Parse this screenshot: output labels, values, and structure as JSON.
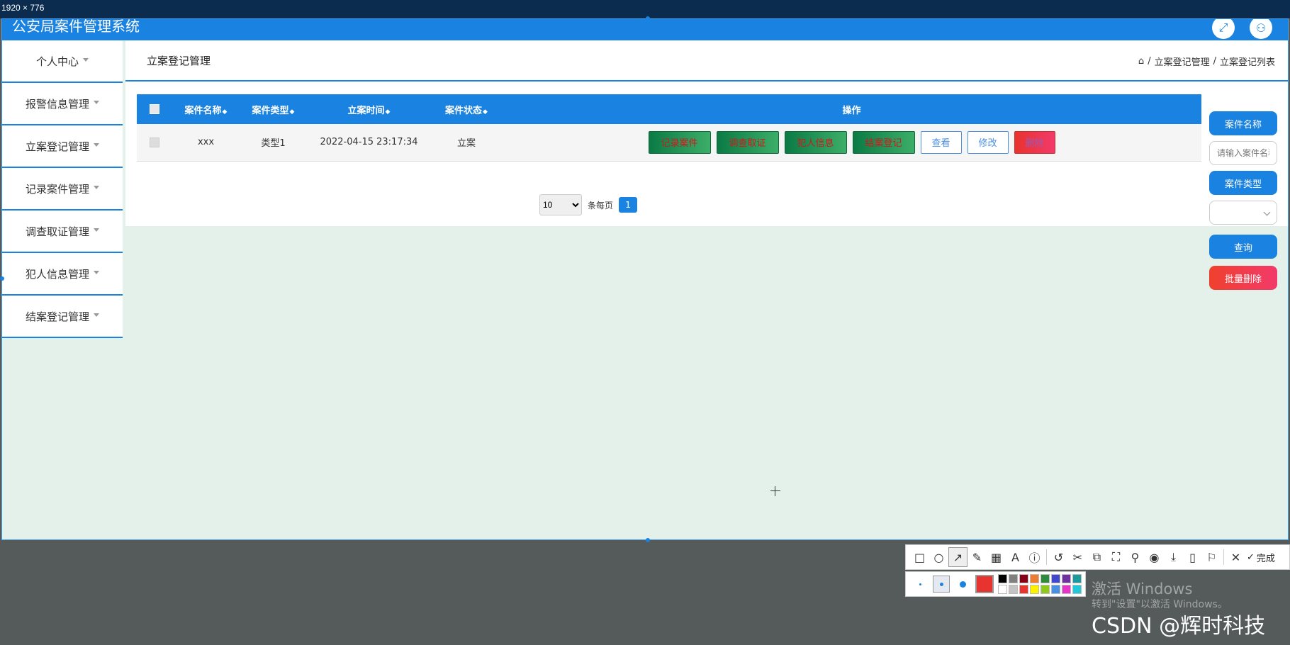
{
  "screen": {
    "dimension_label": "1920 × 776"
  },
  "header": {
    "title": "公安局案件管理系统"
  },
  "sidebar": {
    "items": [
      {
        "label": "个人中心"
      },
      {
        "label": "报警信息管理"
      },
      {
        "label": "立案登记管理"
      },
      {
        "label": "记录案件管理"
      },
      {
        "label": "调查取证管理"
      },
      {
        "label": "犯人信息管理"
      },
      {
        "label": "结案登记管理"
      }
    ]
  },
  "panel": {
    "title": "立案登记管理",
    "breadcrumb": [
      "立案登记管理",
      "立案登记列表"
    ],
    "breadcrumb_sep": "/"
  },
  "table": {
    "columns": [
      "案件名称",
      "案件类型",
      "立案时间",
      "案件状态",
      "操作"
    ],
    "sort_glyph": "◆",
    "rows": [
      {
        "name": "xxx",
        "type": "类型1",
        "time": "2022-04-15 23:17:34",
        "status": "立案",
        "actions": {
          "record": "记录案件",
          "investigate": "调查取证",
          "criminal": "犯人信息",
          "close": "结案登记",
          "view": "查看",
          "edit": "修改",
          "delete": "删除"
        }
      }
    ]
  },
  "pager": {
    "page_size": "10",
    "page_size_options": [
      "10"
    ],
    "per_page_label": "条每页",
    "current_page": "1"
  },
  "search": {
    "name_label": "案件名称",
    "name_placeholder": "请输入案件名称",
    "type_label": "案件类型",
    "query_button": "查询",
    "batch_delete_button": "批量删除"
  },
  "toolbar": {
    "done_label": "完成",
    "colors": [
      "#000000",
      "#7f7f7f",
      "#880015",
      "#ed7d31",
      "#2e8b3e",
      "#3f48cc",
      "#7030a0",
      "#1a9a9a",
      "#ffffff",
      "#c3c3c3",
      "#e8332e",
      "#fff200",
      "#8fc81c",
      "#4a90e2",
      "#e535c8",
      "#22c8d8"
    ],
    "current_color": "#e8332e"
  },
  "watermark": {
    "activate_line1": "激活 Windows",
    "activate_line2": "转到\"设置\"以激活 Windows。",
    "csdn": "CSDN @辉时科技"
  }
}
